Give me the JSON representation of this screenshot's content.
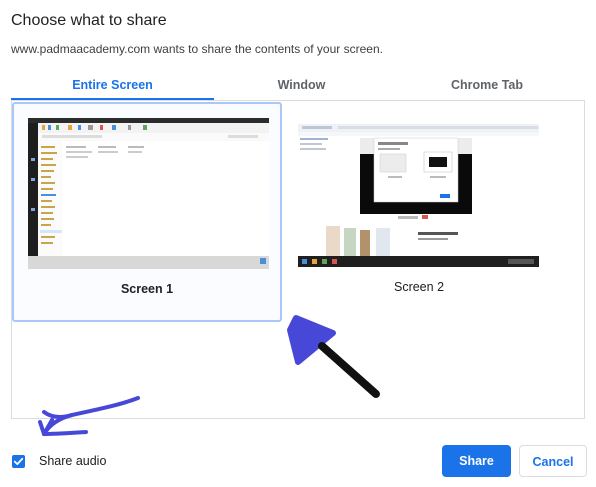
{
  "dialog": {
    "title": "Choose what to share",
    "subtitle": "www.padmaacademy.com wants to share the contents of your screen."
  },
  "tabs": [
    {
      "label": "Entire Screen",
      "active": true
    },
    {
      "label": "Window",
      "active": false
    },
    {
      "label": "Chrome Tab",
      "active": false
    }
  ],
  "screens": [
    {
      "label": "Screen 1",
      "selected": true
    },
    {
      "label": "Screen 2",
      "selected": false
    }
  ],
  "footer": {
    "share_audio_label": "Share audio",
    "share_audio_checked": true,
    "share_label": "Share",
    "cancel_label": "Cancel"
  },
  "colors": {
    "accent": "#1a73e8",
    "annotation_ink": "#4848d8",
    "annotation_arrow": "#111111"
  },
  "icons": [
    "checkbox-checked-icon",
    "hand-drawn-arrow-icon"
  ]
}
